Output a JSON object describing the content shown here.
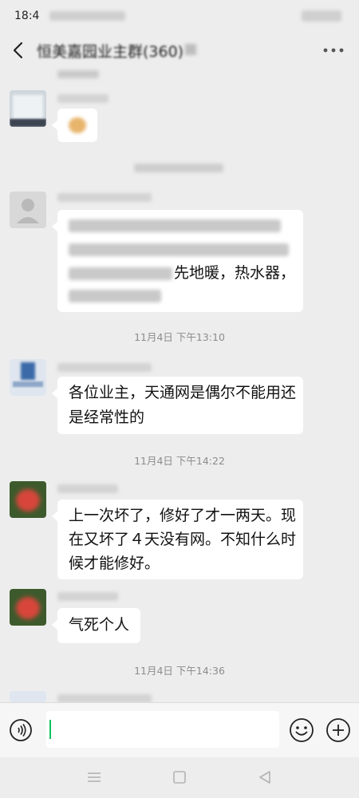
{
  "status_bar": {
    "time": "18:4"
  },
  "header": {
    "title": "恒美嘉园业主群(360)"
  },
  "messages": [
    {
      "bubble_text": "先地暖，热水器，"
    },
    {
      "timestamp": "11月4日 下午13:10",
      "bubble_lines": [
        "各位业主，天通网是偶尔不能用还",
        "是经常性的"
      ]
    },
    {
      "timestamp": "11月4日 下午14:22",
      "bubble_lines": [
        "上一次坏了，修好了才一两天。现",
        "在又坏了４天没有网。不知什么时",
        "候才能修好。"
      ]
    },
    {
      "bubble_text": "气死个人"
    },
    {
      "timestamp": "11月4日 下午14:36"
    }
  ],
  "input_bar": {
    "placeholder": ""
  },
  "icons": {
    "back": "chevron-left-icon",
    "more": "more-dots-icon",
    "voice": "voice-icon",
    "emoji": "emoji-icon",
    "plus": "plus-icon"
  },
  "colors": {
    "accent": "#07c160",
    "background": "#ededed",
    "bubble": "#ffffff"
  }
}
